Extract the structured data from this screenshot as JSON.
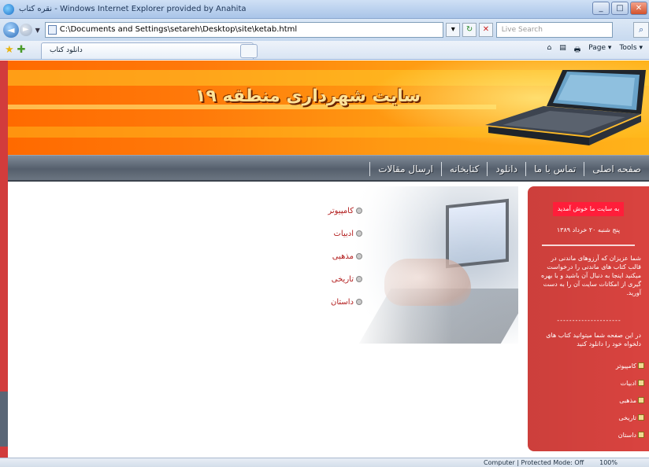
{
  "window": {
    "title": "نقره کتاب - Windows Internet Explorer provided by Anahita",
    "buttons": {
      "minimize": "_",
      "maximize": "□",
      "close": "✕"
    }
  },
  "addressbar": {
    "back": "◄",
    "forward": "►",
    "url": "C:\\Documents and Settings\\setareh\\Desktop\\site\\ketab.html",
    "search_placeholder": "Live Search",
    "search_go": "⌕"
  },
  "favorites": {
    "tab_title": "دانلود کتاب",
    "commands": [
      "⌂",
      "▤",
      "🖶",
      "Page ▾",
      "Tools ▾"
    ]
  },
  "page": {
    "site_title": "سایت شهرداری منطقه ۱۹",
    "nav": [
      "صفحه اصلی",
      "تماس با ما",
      "دانلود",
      "کتابخانه",
      "ارسال مقالات"
    ],
    "content_links": [
      "کامپیوتر",
      "ادبیات",
      "مذهبی",
      "تاریخی",
      "داستان"
    ],
    "sidebar": {
      "welcome": "به سایت ما خوش آمدید",
      "date": "پنج شنبه ۲۰ خرداد ۱۳۸۹",
      "para1": "شما عزیزان که آرزوهای ماندنی در قالب کتاب های ماندنی را درخواست میکنید اینجا به دنبال آن باشید و با بهره گیری از امکانات سایت آن را به دست آورید.",
      "dashes": "---------------------",
      "para2": "در این صفحه شما میتوانید کتاب های دلخواه خود را دانلود کنید",
      "links": [
        "کامپیوتر",
        "ادبیات",
        "مذهبی",
        "تاریخی",
        "داستان"
      ]
    }
  },
  "status": {
    "zone": "Computer | Protected Mode: Off",
    "zoom": "100%"
  },
  "colors": {
    "banner_orange": "#ff7a0a",
    "nav_grey": "#5b6572",
    "sidebar_red": "#d9433f",
    "welcome_red": "#ff1e3a",
    "link_red": "#b32020"
  }
}
